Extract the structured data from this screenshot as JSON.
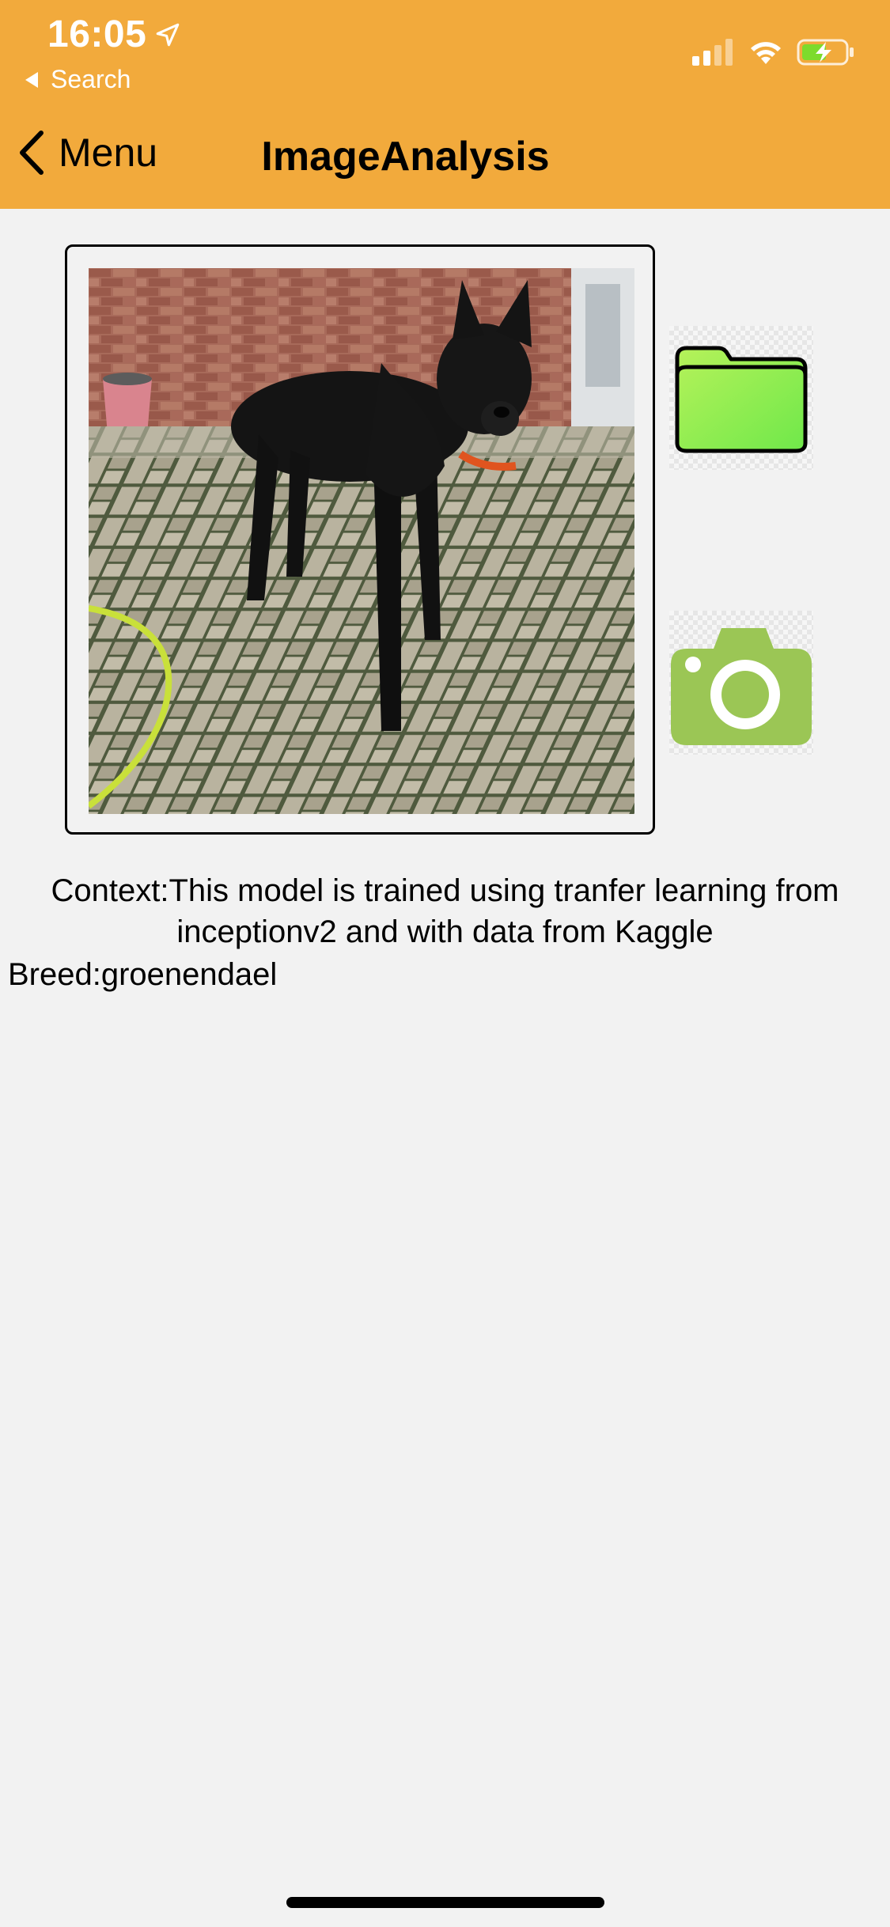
{
  "status_bar": {
    "time": "16:05",
    "back_app": "Search"
  },
  "nav": {
    "back_label": "Menu",
    "title": "ImageAnalysis"
  },
  "image_panel": {
    "photo_icon": "dog-photo"
  },
  "actions": {
    "folder_icon": "folder-icon",
    "camera_icon": "camera-icon"
  },
  "result": {
    "context_label": "Context:",
    "context_text": "This model is trained using tranfer learning from inceptionv2 and with data from Kaggle",
    "breed_label": "Breed:",
    "breed_value": "groenendael"
  },
  "colors": {
    "header": "#f2aa3c",
    "background": "#f2f2f2",
    "folder_green": "#8ef25a",
    "camera_green": "#9bc655"
  }
}
